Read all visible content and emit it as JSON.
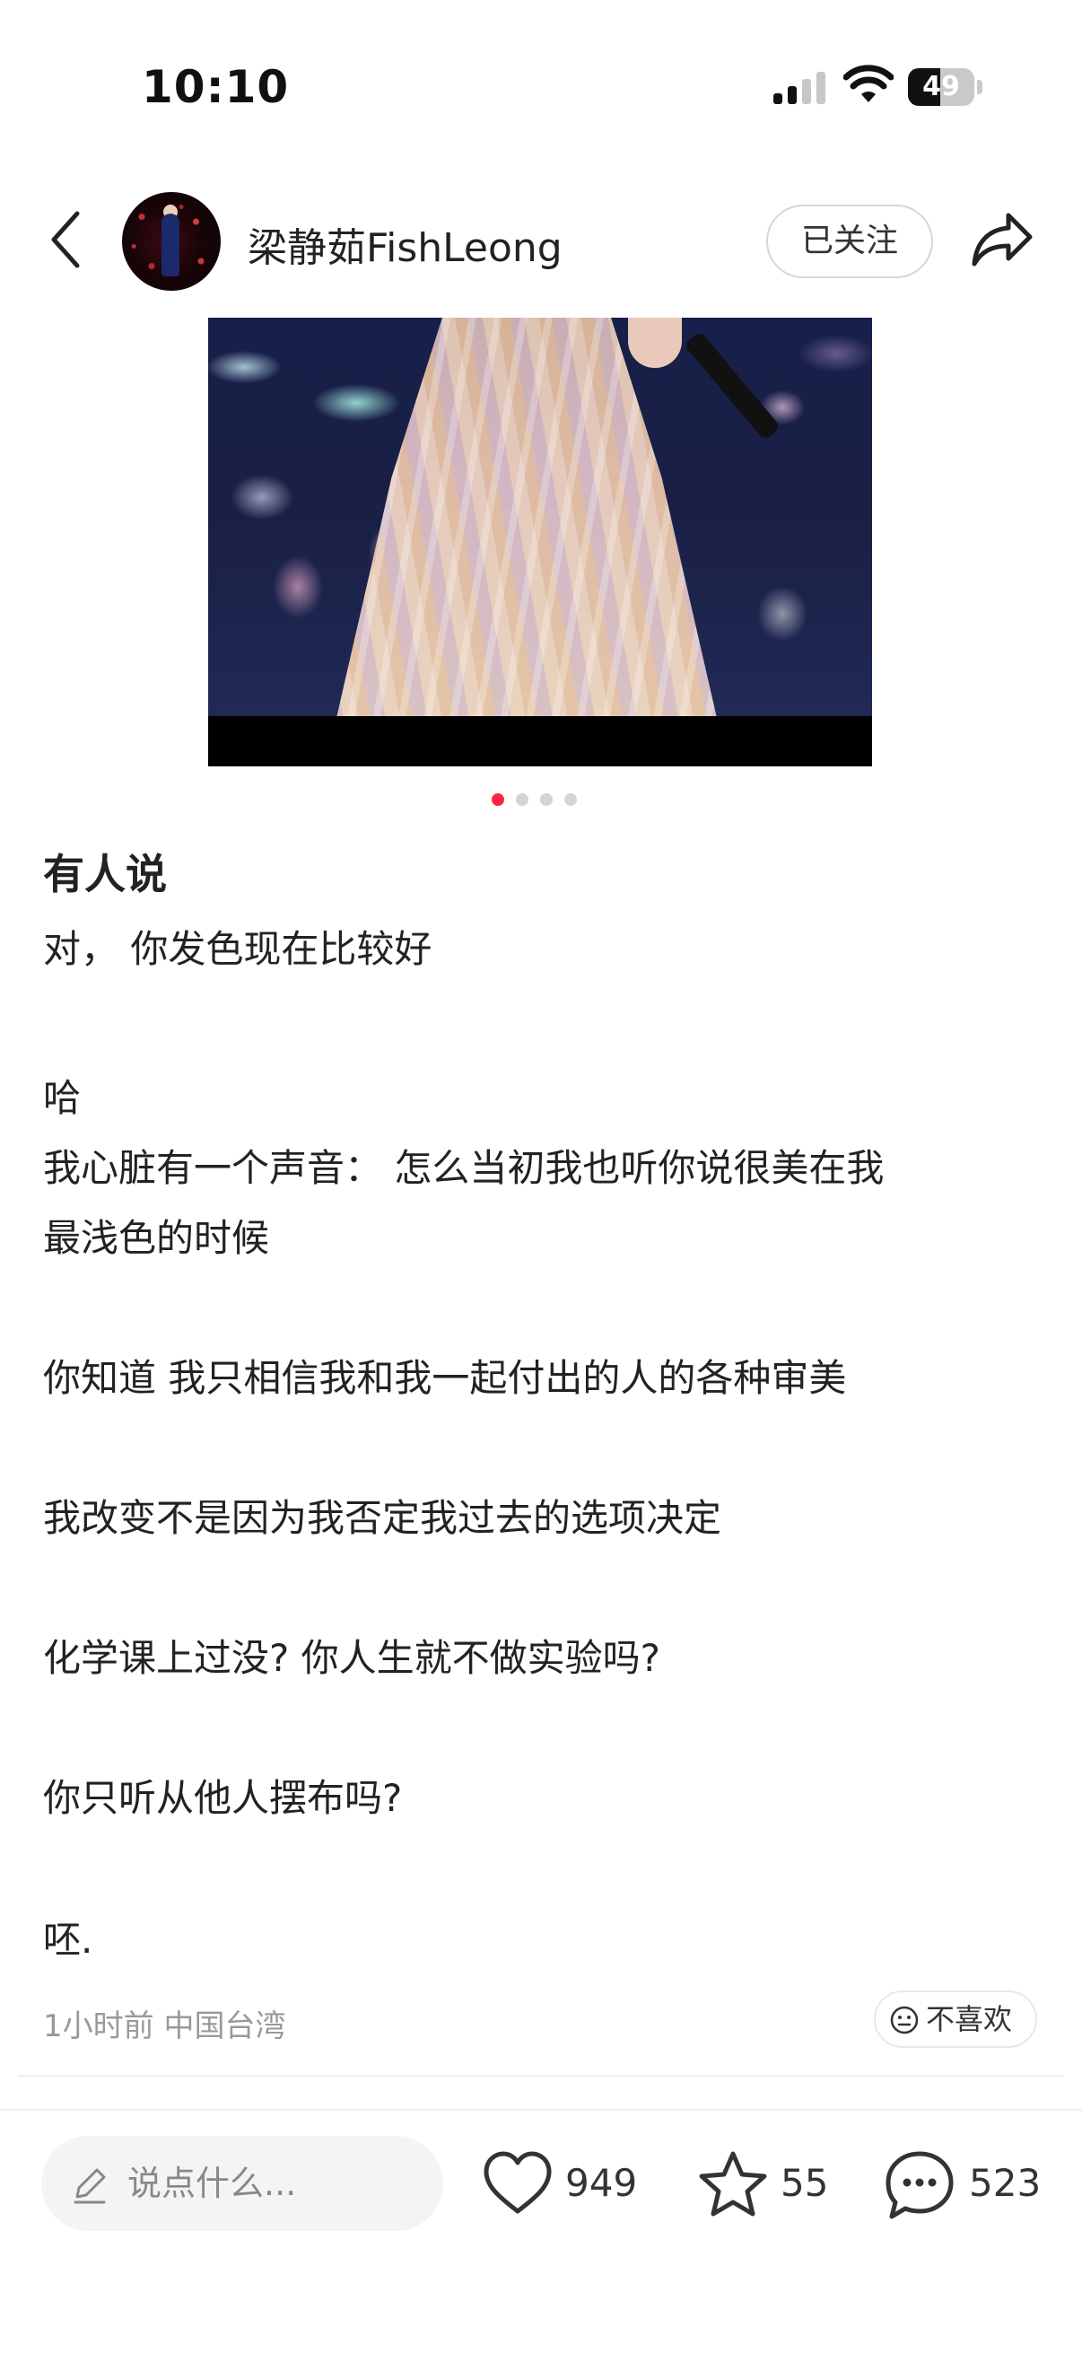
{
  "status_bar": {
    "time": "10:10",
    "battery": "49",
    "battery_level": 0.49
  },
  "header": {
    "username": "梁静茹FishLeong",
    "follow_label": "已关注",
    "icons": [
      "back-arrow-icon",
      "avatar",
      "share-icon"
    ]
  },
  "carousel": {
    "total": 4,
    "active_index": 0
  },
  "post": {
    "title": "有人说",
    "lines": [
      "对， 你发色现在比较好",
      "哈",
      "我心脏有一个声音：  怎么当初我也听你说很美在我",
      "最浅色的时候",
      "你知道 我只相信我和我一起付出的人的各种审美",
      "我改变不是因为我否定我过去的选项决定",
      "化学课上过没? 你人生就不做实验吗?",
      "你只听从他人摆布吗?",
      "呸."
    ],
    "meta": "1小时前 中国台湾",
    "dislike_label": "不喜欢"
  },
  "bottom_bar": {
    "comment_placeholder": "说点什么...",
    "likes": "949",
    "favorites": "55",
    "comments": "523"
  },
  "colors": {
    "accent": "#ff2442",
    "text": "#222222",
    "muted": "#999999"
  }
}
